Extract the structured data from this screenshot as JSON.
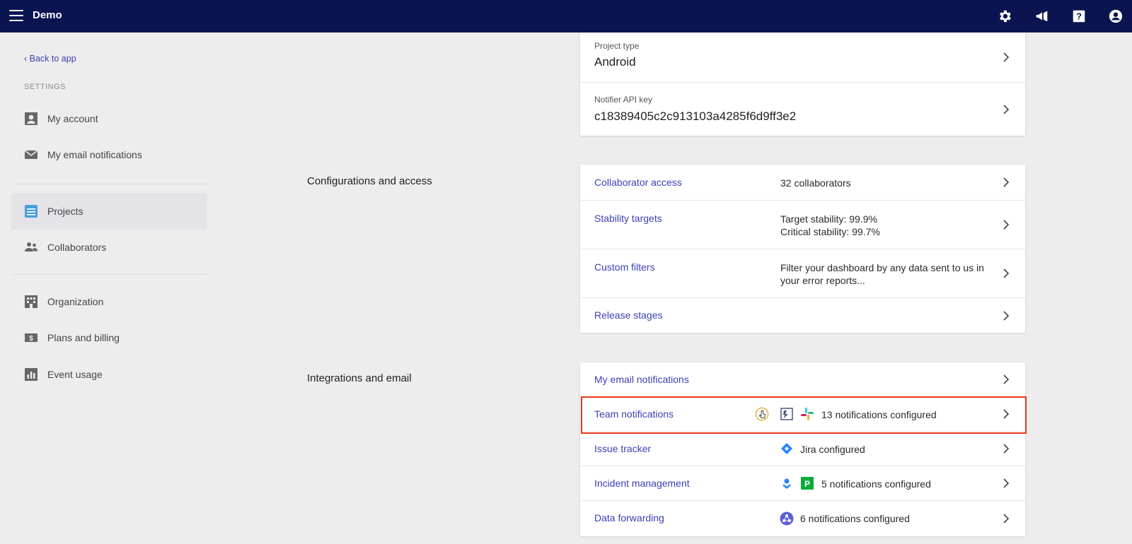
{
  "topbar": {
    "title": "Demo",
    "icons": [
      "menu-icon",
      "gear-icon",
      "megaphone-icon",
      "help-icon",
      "account-icon"
    ]
  },
  "sidebar": {
    "back_link": "‹ Back to app",
    "section_label": "SETTINGS",
    "items": [
      {
        "label": "My account",
        "icon": "person-icon"
      },
      {
        "label": "My email notifications",
        "icon": "envelope-icon"
      },
      {
        "label": "Projects",
        "icon": "projects-icon",
        "active": true
      },
      {
        "label": "Collaborators",
        "icon": "people-icon"
      },
      {
        "label": "Organization",
        "icon": "building-icon"
      },
      {
        "label": "Plans and billing",
        "icon": "billing-icon"
      },
      {
        "label": "Event usage",
        "icon": "bar-chart-icon"
      }
    ]
  },
  "project": {
    "type_label": "Project type",
    "type_value": "Android",
    "api_key_label": "Notifier API key",
    "api_key_value": "c18389405c2c913103a4285f6d9ff3e2"
  },
  "sections": {
    "configurations": "Configurations and access",
    "integrations": "Integrations and email"
  },
  "configurations": [
    {
      "label": "Collaborator access",
      "value": "32 collaborators"
    },
    {
      "label": "Stability targets",
      "value_line1": "Target stability: 99.9%",
      "value_line2": "Critical stability: 99.7%"
    },
    {
      "label": "Custom filters",
      "value": "Filter your dashboard by any data sent to us in your error reports..."
    },
    {
      "label": "Release stages",
      "value": ""
    }
  ],
  "integrations": [
    {
      "label": "My email notifications",
      "value": ""
    },
    {
      "label": "Team notifications",
      "value": "13 notifications configured",
      "icons": [
        "pointer-cursor-icon",
        "integration-icon",
        "slack-icon"
      ]
    },
    {
      "label": "Issue tracker",
      "value": "Jira configured",
      "icons": [
        "jira-icon"
      ]
    },
    {
      "label": "Incident management",
      "value": "5 notifications configured",
      "icons": [
        "opsgenie-icon",
        "pagerduty-icon"
      ]
    },
    {
      "label": "Data forwarding",
      "value": "6 notifications configured",
      "icons": [
        "forwarding-icon"
      ]
    }
  ],
  "colors": {
    "topbar": "#0a1450",
    "link": "#3b3fb6",
    "highlight": "#e8341c",
    "background": "#ededed"
  }
}
